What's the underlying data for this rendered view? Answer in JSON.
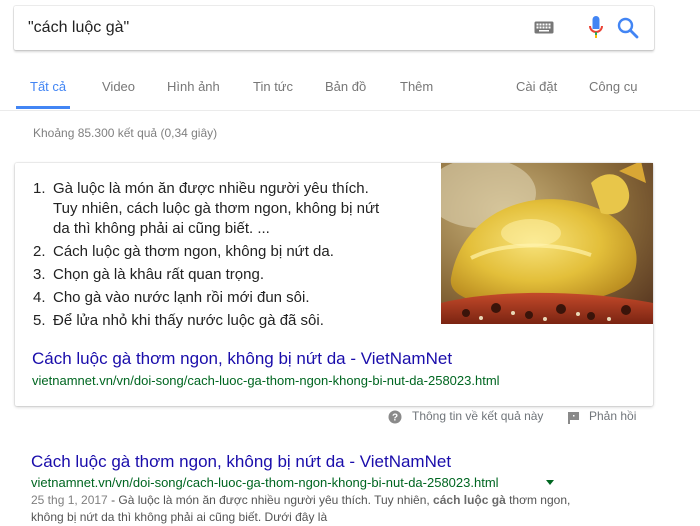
{
  "search": {
    "query": "\"cách luộc gà\""
  },
  "tabs": {
    "all": "Tất cả",
    "video": "Video",
    "images": "Hình ảnh",
    "news": "Tin tức",
    "maps": "Bản đồ",
    "more": "Thêm",
    "settings": "Cài đặt",
    "tools": "Công cụ"
  },
  "stats": "Khoảng 85.300 kết quả (0,34 giây)",
  "snippet": {
    "items": [
      {
        "n": "1.",
        "lines": [
          "Gà luộc là món ăn được nhiều người yêu thích.",
          "Tuy nhiên, cách luộc gà thơm ngon, không bị nứt",
          "da thì không phải ai cũng biết. ..."
        ]
      },
      {
        "n": "2.",
        "lines": [
          "Cách luộc gà thơm ngon, không bị nứt da."
        ]
      },
      {
        "n": "3.",
        "lines": [
          "Chọn gà là khâu rất quan trọng."
        ]
      },
      {
        "n": "4.",
        "lines": [
          "Cho gà vào nước lạnh rồi mới đun sôi."
        ]
      },
      {
        "n": "5.",
        "lines": [
          "Để lửa nhỏ khi thấy nước luộc gà đã sôi."
        ]
      }
    ],
    "link_title": "Cách luộc gà thơm ngon, không bị nứt da - VietNamNet",
    "url": "vietnamnet.vn/vn/doi-song/cach-luoc-ga-thom-ngon-khong-bi-nut-da-258023.html"
  },
  "feedback": {
    "about": "Thông tin về kết quả này",
    "report": "Phản hồi"
  },
  "result": {
    "title": "Cách luộc gà thơm ngon, không bị nứt da - VietNamNet",
    "url": "vietnamnet.vn/vn/doi-song/cach-luoc-ga-thom-ngon-khong-bi-nut-da-258023.html",
    "date": "25 thg 1, 2017",
    "snippet_a": " - Gà luộc là món ăn được nhiều người yêu thích. Tuy nhiên, ",
    "snippet_bold": "cách luộc gà",
    "snippet_b": " thơm ngon,",
    "snippet_line2": "không bị nứt da thì không phải ai cũng biết. Dưới đây là"
  },
  "colors": {
    "link": "#1a0dab",
    "url": "#006621",
    "accent": "#4285f4"
  }
}
